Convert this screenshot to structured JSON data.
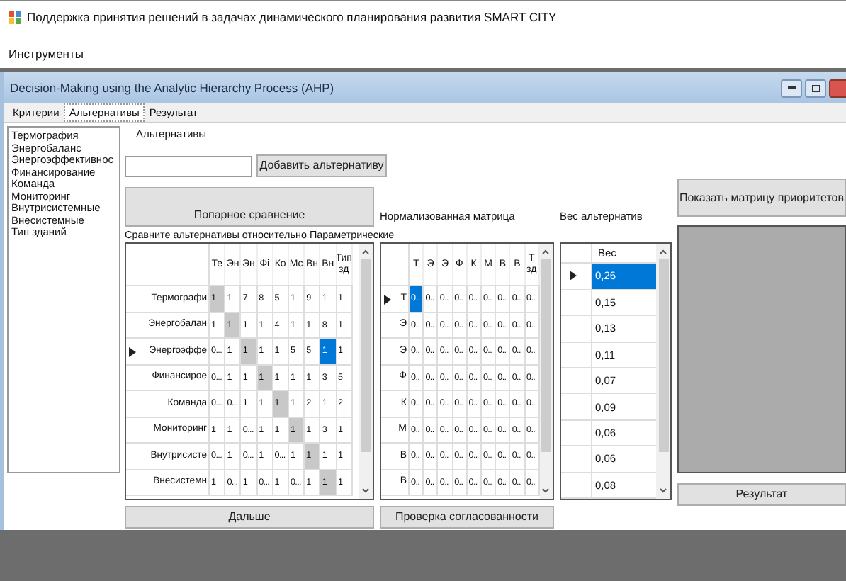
{
  "app": {
    "title": "Поддержка принятия решений в задачах динамического планирования развития SMART CITY"
  },
  "menu": [
    "Инструменты"
  ],
  "window": {
    "title": "Decision-Making using the Analytic Hierarchy Process (AHP)"
  },
  "tabs": [
    {
      "label": "Критерии",
      "selected": false
    },
    {
      "label": "Альтернативы",
      "selected": true
    },
    {
      "label": "Результат",
      "selected": false
    }
  ],
  "criteria_list": [
    "Термография",
    "Энергобаланс",
    "Энергоэффективнос",
    "Финансирование",
    "Команда",
    "Мониторинг",
    "Внутрисистемные",
    "Внесистемные",
    "Тип зданий"
  ],
  "group_title": "Альтернативы",
  "add_button": "Добавить альтернативу",
  "pairwise_button": "Попарное сравнение",
  "compare_label": "Сравните альтернативы относительно Параметрические",
  "comparison": {
    "columns": [
      "Те",
      "Эн",
      "Эн",
      "Фі",
      "Ко",
      "Мс",
      "Вн",
      "Вн",
      "Тип зд"
    ],
    "rows": [
      {
        "header": "Термографи",
        "selected": false,
        "cells": [
          {
            "text": "1",
            "shaded": true,
            "selected": false
          },
          {
            "text": "1",
            "shaded": false,
            "selected": false
          },
          {
            "text": "7",
            "shaded": false,
            "selected": false
          },
          {
            "text": "8",
            "shaded": false,
            "selected": false
          },
          {
            "text": "5",
            "shaded": false,
            "selected": false
          },
          {
            "text": "1",
            "shaded": false,
            "selected": false
          },
          {
            "text": "9",
            "shaded": false,
            "selected": false
          },
          {
            "text": "1",
            "shaded": false,
            "selected": false
          },
          {
            "text": "1",
            "shaded": false,
            "selected": false
          }
        ]
      },
      {
        "header": "Энергобалан",
        "selected": false,
        "cells": [
          {
            "text": "1",
            "shaded": false,
            "selected": false
          },
          {
            "text": "1",
            "shaded": true,
            "selected": false
          },
          {
            "text": "1",
            "shaded": false,
            "selected": false
          },
          {
            "text": "1",
            "shaded": false,
            "selected": false
          },
          {
            "text": "4",
            "shaded": false,
            "selected": false
          },
          {
            "text": "1",
            "shaded": false,
            "selected": false
          },
          {
            "text": "1",
            "shaded": false,
            "selected": false
          },
          {
            "text": "8",
            "shaded": false,
            "selected": false
          },
          {
            "text": "1",
            "shaded": false,
            "selected": false
          }
        ]
      },
      {
        "header": "Энергоэффе",
        "selected": true,
        "cells": [
          {
            "text": "0...",
            "shaded": false,
            "selected": false
          },
          {
            "text": "1",
            "shaded": false,
            "selected": false
          },
          {
            "text": "1",
            "shaded": true,
            "selected": false
          },
          {
            "text": "1",
            "shaded": false,
            "selected": false
          },
          {
            "text": "1",
            "shaded": false,
            "selected": false
          },
          {
            "text": "5",
            "shaded": false,
            "selected": false
          },
          {
            "text": "5",
            "shaded": false,
            "selected": false
          },
          {
            "text": "1",
            "shaded": false,
            "selected": true
          },
          {
            "text": "1",
            "shaded": false,
            "selected": false
          }
        ]
      },
      {
        "header": "Финансирое",
        "selected": false,
        "cells": [
          {
            "text": "0...",
            "shaded": false,
            "selected": false
          },
          {
            "text": "1",
            "shaded": false,
            "selected": false
          },
          {
            "text": "1",
            "shaded": false,
            "selected": false
          },
          {
            "text": "1",
            "shaded": true,
            "selected": false
          },
          {
            "text": "1",
            "shaded": false,
            "selected": false
          },
          {
            "text": "1",
            "shaded": false,
            "selected": false
          },
          {
            "text": "1",
            "shaded": false,
            "selected": false
          },
          {
            "text": "3",
            "shaded": false,
            "selected": false
          },
          {
            "text": "5",
            "shaded": false,
            "selected": false
          }
        ]
      },
      {
        "header": "Команда",
        "selected": false,
        "cells": [
          {
            "text": "0...",
            "shaded": false,
            "selected": false
          },
          {
            "text": "0...",
            "shaded": false,
            "selected": false
          },
          {
            "text": "1",
            "shaded": false,
            "selected": false
          },
          {
            "text": "1",
            "shaded": false,
            "selected": false
          },
          {
            "text": "1",
            "shaded": true,
            "selected": false
          },
          {
            "text": "1",
            "shaded": false,
            "selected": false
          },
          {
            "text": "2",
            "shaded": false,
            "selected": false
          },
          {
            "text": "1",
            "shaded": false,
            "selected": false
          },
          {
            "text": "2",
            "shaded": false,
            "selected": false
          }
        ]
      },
      {
        "header": "Мониторинг",
        "selected": false,
        "cells": [
          {
            "text": "1",
            "shaded": false,
            "selected": false
          },
          {
            "text": "1",
            "shaded": false,
            "selected": false
          },
          {
            "text": "0...",
            "shaded": false,
            "selected": false
          },
          {
            "text": "1",
            "shaded": false,
            "selected": false
          },
          {
            "text": "1",
            "shaded": false,
            "selected": false
          },
          {
            "text": "1",
            "shaded": true,
            "selected": false
          },
          {
            "text": "1",
            "shaded": false,
            "selected": false
          },
          {
            "text": "3",
            "shaded": false,
            "selected": false
          },
          {
            "text": "1",
            "shaded": false,
            "selected": false
          }
        ]
      },
      {
        "header": "Внутрисисте",
        "selected": false,
        "cells": [
          {
            "text": "0...",
            "shaded": false,
            "selected": false
          },
          {
            "text": "1",
            "shaded": false,
            "selected": false
          },
          {
            "text": "0...",
            "shaded": false,
            "selected": false
          },
          {
            "text": "1",
            "shaded": false,
            "selected": false
          },
          {
            "text": "0...",
            "shaded": false,
            "selected": false
          },
          {
            "text": "1",
            "shaded": false,
            "selected": false
          },
          {
            "text": "1",
            "shaded": true,
            "selected": false
          },
          {
            "text": "1",
            "shaded": false,
            "selected": false
          },
          {
            "text": "1",
            "shaded": false,
            "selected": false
          }
        ]
      },
      {
        "header": "Внесистемн",
        "selected": false,
        "cells": [
          {
            "text": "1",
            "shaded": false,
            "selected": false
          },
          {
            "text": "0...",
            "shaded": false,
            "selected": false
          },
          {
            "text": "1",
            "shaded": false,
            "selected": false
          },
          {
            "text": "0...",
            "shaded": false,
            "selected": false
          },
          {
            "text": "1",
            "shaded": false,
            "selected": false
          },
          {
            "text": "0...",
            "shaded": false,
            "selected": false
          },
          {
            "text": "1",
            "shaded": false,
            "selected": false
          },
          {
            "text": "1",
            "shaded": true,
            "selected": false
          },
          {
            "text": "1",
            "shaded": false,
            "selected": false
          }
        ]
      }
    ]
  },
  "next_button": "Дальше",
  "normalized_label": "Нормализованная матрица",
  "normalized": {
    "columns": [
      "Т",
      "Э",
      "Э",
      "Ф",
      "К",
      "М",
      "В",
      "В",
      "Т зд"
    ],
    "rows": [
      {
        "header": "Т",
        "selected": true,
        "cells": [
          {
            "text": "0..",
            "selected": true
          },
          {
            "text": "0..",
            "selected": false
          },
          {
            "text": "0..",
            "selected": false
          },
          {
            "text": "0..",
            "selected": false
          },
          {
            "text": "0..",
            "selected": false
          },
          {
            "text": "0..",
            "selected": false
          },
          {
            "text": "0..",
            "selected": false
          },
          {
            "text": "0..",
            "selected": false
          },
          {
            "text": "0..",
            "selected": false
          }
        ]
      },
      {
        "header": "Э",
        "selected": false,
        "cells": [
          {
            "text": "0..",
            "selected": false
          },
          {
            "text": "0..",
            "selected": false
          },
          {
            "text": "0..",
            "selected": false
          },
          {
            "text": "0..",
            "selected": false
          },
          {
            "text": "0..",
            "selected": false
          },
          {
            "text": "0..",
            "selected": false
          },
          {
            "text": "0..",
            "selected": false
          },
          {
            "text": "0..",
            "selected": false
          },
          {
            "text": "0..",
            "selected": false
          }
        ]
      },
      {
        "header": "Э",
        "selected": false,
        "cells": [
          {
            "text": "0..",
            "selected": false
          },
          {
            "text": "0..",
            "selected": false
          },
          {
            "text": "0..",
            "selected": false
          },
          {
            "text": "0..",
            "selected": false
          },
          {
            "text": "0..",
            "selected": false
          },
          {
            "text": "0..",
            "selected": false
          },
          {
            "text": "0..",
            "selected": false
          },
          {
            "text": "0..",
            "selected": false
          },
          {
            "text": "0..",
            "selected": false
          }
        ]
      },
      {
        "header": "Ф",
        "selected": false,
        "cells": [
          {
            "text": "0..",
            "selected": false
          },
          {
            "text": "0..",
            "selected": false
          },
          {
            "text": "0..",
            "selected": false
          },
          {
            "text": "0..",
            "selected": false
          },
          {
            "text": "0..",
            "selected": false
          },
          {
            "text": "0..",
            "selected": false
          },
          {
            "text": "0..",
            "selected": false
          },
          {
            "text": "0..",
            "selected": false
          },
          {
            "text": "0..",
            "selected": false
          }
        ]
      },
      {
        "header": "К",
        "selected": false,
        "cells": [
          {
            "text": "0..",
            "selected": false
          },
          {
            "text": "0..",
            "selected": false
          },
          {
            "text": "0..",
            "selected": false
          },
          {
            "text": "0..",
            "selected": false
          },
          {
            "text": "0..",
            "selected": false
          },
          {
            "text": "0..",
            "selected": false
          },
          {
            "text": "0..",
            "selected": false
          },
          {
            "text": "0..",
            "selected": false
          },
          {
            "text": "0..",
            "selected": false
          }
        ]
      },
      {
        "header": "М",
        "selected": false,
        "cells": [
          {
            "text": "0..",
            "selected": false
          },
          {
            "text": "0..",
            "selected": false
          },
          {
            "text": "0..",
            "selected": false
          },
          {
            "text": "0..",
            "selected": false
          },
          {
            "text": "0..",
            "selected": false
          },
          {
            "text": "0..",
            "selected": false
          },
          {
            "text": "0..",
            "selected": false
          },
          {
            "text": "0..",
            "selected": false
          },
          {
            "text": "0..",
            "selected": false
          }
        ]
      },
      {
        "header": "В",
        "selected": false,
        "cells": [
          {
            "text": "0..",
            "selected": false
          },
          {
            "text": "0..",
            "selected": false
          },
          {
            "text": "0..",
            "selected": false
          },
          {
            "text": "0..",
            "selected": false
          },
          {
            "text": "0..",
            "selected": false
          },
          {
            "text": "0..",
            "selected": false
          },
          {
            "text": "0..",
            "selected": false
          },
          {
            "text": "0..",
            "selected": false
          },
          {
            "text": "0..",
            "selected": false
          }
        ]
      },
      {
        "header": "В",
        "selected": false,
        "cells": [
          {
            "text": "0..",
            "selected": false
          },
          {
            "text": "0..",
            "selected": false
          },
          {
            "text": "0..",
            "selected": false
          },
          {
            "text": "0..",
            "selected": false
          },
          {
            "text": "0..",
            "selected": false
          },
          {
            "text": "0..",
            "selected": false
          },
          {
            "text": "0..",
            "selected": false
          },
          {
            "text": "0..",
            "selected": false
          },
          {
            "text": "0..",
            "selected": false
          }
        ]
      }
    ]
  },
  "check_button": "Проверка согласованности",
  "weights_label": "Вес альтернатив",
  "weights": {
    "column": "Вес",
    "rows": [
      {
        "value": "0,26",
        "selected": true
      },
      {
        "value": "0,15",
        "selected": false
      },
      {
        "value": "0,13",
        "selected": false
      },
      {
        "value": "0,11",
        "selected": false
      },
      {
        "value": "0,07",
        "selected": false
      },
      {
        "value": "0,09",
        "selected": false
      },
      {
        "value": "0,06",
        "selected": false
      },
      {
        "value": "0,06",
        "selected": false
      },
      {
        "value": "0,08",
        "selected": false
      }
    ]
  },
  "priority_button": "Показать матрицу приоритетов",
  "result_button": "Результат"
}
